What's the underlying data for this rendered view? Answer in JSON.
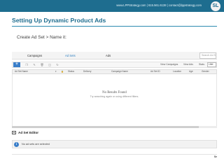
{
  "header": {
    "contact": "www.LPPStrategy.com | 615.561.6138 | contact@lppstrategy.com",
    "logo_text": "SL"
  },
  "slide": {
    "title": "Setting Up Dynamic Product Ads",
    "subtitle": "Create Ad Set > Name it:"
  },
  "app": {
    "tabs": [
      "Campaigns",
      "Ad Sets",
      "Ads"
    ],
    "active_tab": "Ad Sets",
    "search_placeholder": "Search Ad S",
    "toolbar": {
      "add_label": "+",
      "view_campaigns": "View Campaigns",
      "view_ads": "View Ads",
      "stats_label": "Stats:",
      "stats_value": "Lifet"
    },
    "columns": [
      "Ad Set Name",
      "Status",
      "Delivery",
      "Campaign Name",
      "Ad Set ID",
      "Location",
      "Age",
      "Gender"
    ],
    "empty_state": {
      "title": "No Results Found",
      "hint": "Try searching again or using different filters."
    },
    "editor": {
      "title": "Ad Set Editor",
      "notice": "No ad sets are selected"
    },
    "bottom_label": "Se"
  },
  "colors": {
    "brand": "#1e6d8f",
    "accent_blue": "#3a7ec9"
  }
}
